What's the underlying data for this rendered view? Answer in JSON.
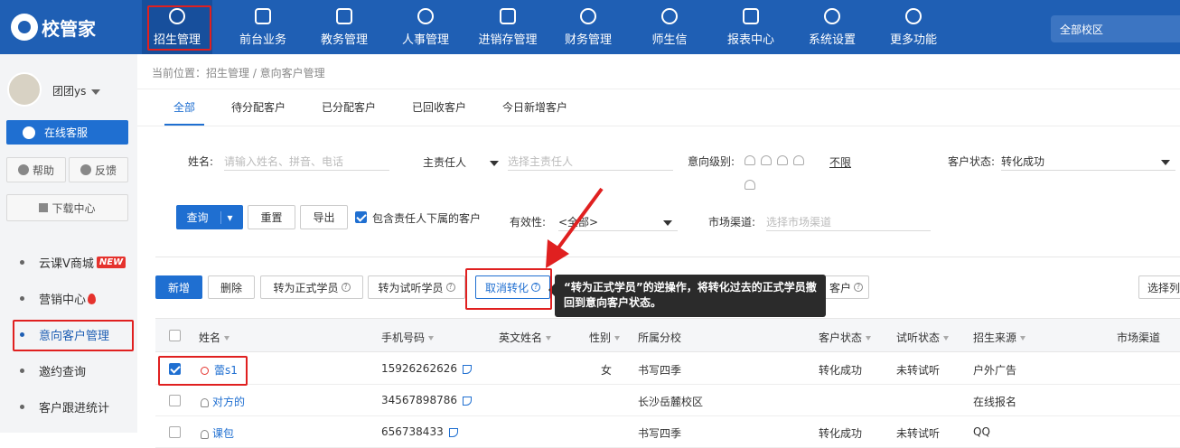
{
  "brand": {
    "name": "校管家"
  },
  "nav": [
    {
      "label": "招生管理",
      "icon": "user-plus-icon"
    },
    {
      "label": "前台业务",
      "icon": "front-desk-icon"
    },
    {
      "label": "教务管理",
      "icon": "book-icon"
    },
    {
      "label": "人事管理",
      "icon": "person-icon"
    },
    {
      "label": "进销存管理",
      "icon": "inventory-icon"
    },
    {
      "label": "财务管理",
      "icon": "finance-icon"
    },
    {
      "label": "师生信",
      "icon": "message-icon"
    },
    {
      "label": "报表中心",
      "icon": "report-icon"
    },
    {
      "label": "系统设置",
      "icon": "settings-icon"
    },
    {
      "label": "更多功能",
      "icon": "more-icon"
    }
  ],
  "campus": "全部校区",
  "user": {
    "name": "团团ys"
  },
  "sidebar": {
    "service_btn": "在线客服",
    "help": "帮助",
    "feedback": "反馈",
    "download": "下载中心",
    "items": [
      {
        "label": "云课V商城",
        "badge": "NEW"
      },
      {
        "label": "营销中心"
      },
      {
        "label": "意向客户管理"
      },
      {
        "label": "邀约查询"
      },
      {
        "label": "客户跟进统计"
      }
    ]
  },
  "breadcrumb": "当前位置：招生管理 / 意向客户管理",
  "tabs": [
    "全部",
    "待分配客户",
    "已分配客户",
    "已回收客户",
    "今日新增客户"
  ],
  "filters": {
    "name_label": "姓名:",
    "name_placeholder": "请输入姓名、拼音、电话",
    "owner_label": "主责任人",
    "owner_placeholder": "选择主责任人",
    "level_label": "意向级别:",
    "level_unlimited": "不限",
    "status_label": "客户状态:",
    "status_value": "转化成功",
    "validity_label": "有效性:",
    "validity_value": "<全部>",
    "channel_label": "市场渠道:",
    "channel_placeholder": "选择市场渠道",
    "include_sub": "包含责任人下属的客户"
  },
  "query_buttons": {
    "query": "查询",
    "reset": "重置",
    "export": "导出"
  },
  "actions": {
    "add": "新增",
    "delete": "删除",
    "to_formal": "转为正式学员",
    "to_trial": "转为试听学员",
    "cancel_convert": "取消转化",
    "partial": "客户",
    "select_cols": "选择列"
  },
  "tooltip": "“转为正式学员”的逆操作，将转化过去的正式学员撤回到意向客户状态。",
  "table": {
    "headers": [
      "姓名",
      "手机号码",
      "英文姓名",
      "性别",
      "所属分校",
      "客户状态",
      "试听状态",
      "招生来源",
      "市场渠道"
    ],
    "rows": [
      {
        "name": "蕾s1",
        "phone": "15926262626",
        "en": "",
        "gender": "女",
        "campus": "书写四季",
        "status": "转化成功",
        "trial": "未转试听",
        "source": "户外广告",
        "checked": true
      },
      {
        "name": "对方的",
        "phone": "34567898786",
        "en": "",
        "gender": "",
        "campus": "长沙岳麓校区",
        "status": "",
        "trial": "",
        "source": "在线报名",
        "checked": false
      },
      {
        "name": "课包",
        "phone": "656738433",
        "en": "",
        "gender": "",
        "campus": "书写四季",
        "status": "转化成功",
        "trial": "未转试听",
        "source": "QQ",
        "checked": false
      }
    ]
  }
}
